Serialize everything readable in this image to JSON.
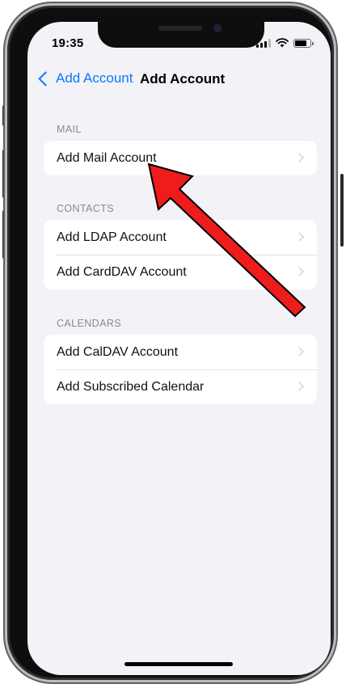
{
  "status_bar": {
    "time": "19:35"
  },
  "nav": {
    "back_label": "Add Account",
    "title": "Add Account"
  },
  "sections": [
    {
      "header": "MAIL",
      "items": [
        "Add Mail Account"
      ]
    },
    {
      "header": "CONTACTS",
      "items": [
        "Add LDAP Account",
        "Add CardDAV Account"
      ]
    },
    {
      "header": "CALENDARS",
      "items": [
        "Add CalDAV Account",
        "Add Subscribed Calendar"
      ]
    }
  ],
  "colors": {
    "accent": "#0a7aff",
    "background": "#f2f2f7",
    "annotation_arrow": "#ee1c1c"
  },
  "icons": [
    "back-chevron-icon",
    "chevron-right-icon",
    "signal-icon",
    "wifi-icon",
    "battery-icon"
  ]
}
